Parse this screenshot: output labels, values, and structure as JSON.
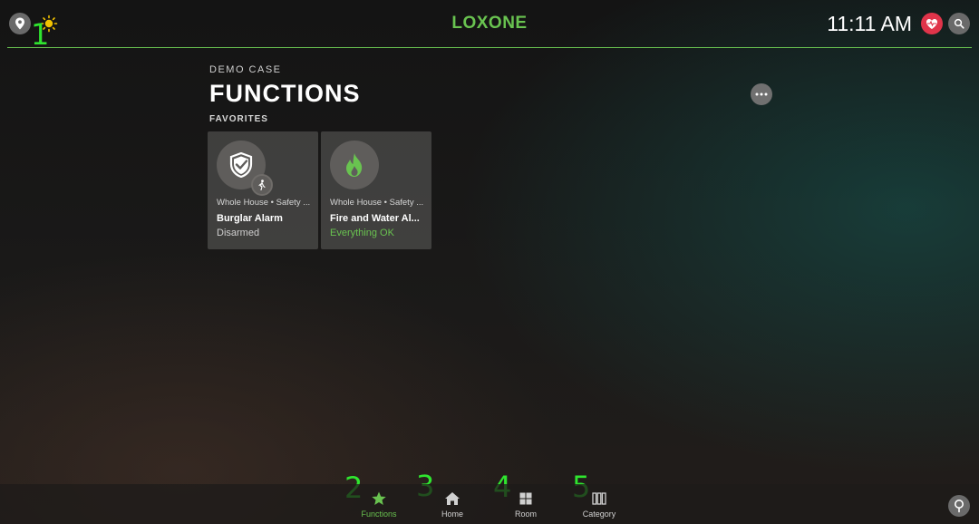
{
  "header": {
    "brand": "LOXONE",
    "time": "11:11 AM",
    "icons": {
      "location": "location-pin-icon",
      "weather": "sun-icon",
      "health": "heart-pulse-icon",
      "search": "search-icon"
    }
  },
  "markers": [
    "1",
    "2",
    "3",
    "4",
    "5"
  ],
  "page": {
    "supertitle": "DEMO CASE",
    "title": "FUNCTIONS",
    "section_label": "FAVORITES"
  },
  "cards": [
    {
      "location": "Whole House • Safety ...",
      "name": "Burglar Alarm",
      "status": "Disarmed",
      "icon": "shield-icon",
      "badge": "walking-person-icon"
    },
    {
      "location": "Whole House • Safety ...",
      "name": "Fire and Water Al...",
      "status": "Everything OK",
      "icon": "flame-icon"
    }
  ],
  "nav": [
    {
      "label": "Functions",
      "icon": "star-icon",
      "active": true
    },
    {
      "label": "Home",
      "icon": "home-icon",
      "active": false
    },
    {
      "label": "Room",
      "icon": "room-grid-icon",
      "active": false
    },
    {
      "label": "Category",
      "icon": "category-icon",
      "active": false
    }
  ],
  "colors": {
    "accent": "#69c350",
    "health": "#e0344a",
    "marker": "#2fe52f"
  }
}
